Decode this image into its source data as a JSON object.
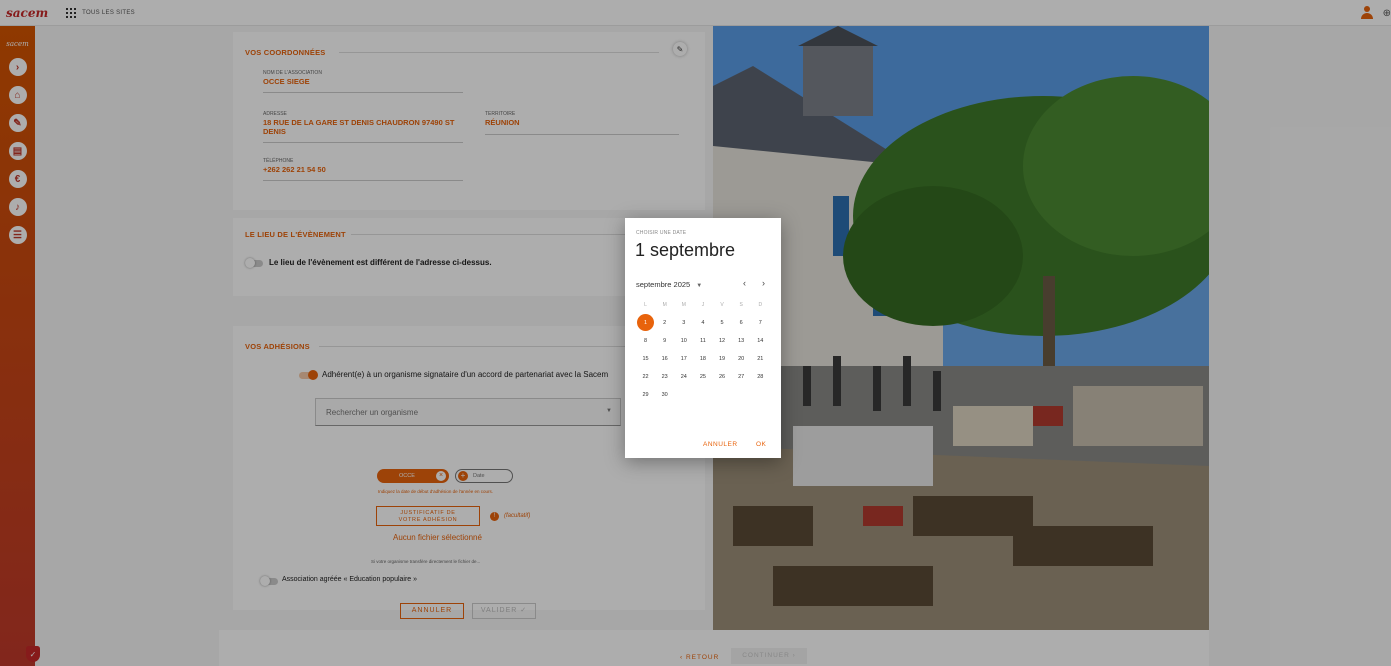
{
  "topbar": {
    "logo": "sacem",
    "all_sites": "TOUS LES SITES"
  },
  "sidebar": {
    "logo": "sacem",
    "items": [
      {
        "icon": "chevron-right-icon",
        "glyph": "›"
      },
      {
        "icon": "home-icon",
        "glyph": "⌂"
      },
      {
        "icon": "pencil-icon",
        "glyph": "✎"
      },
      {
        "icon": "chart-icon",
        "glyph": "▤"
      },
      {
        "icon": "euro-icon",
        "glyph": "€"
      },
      {
        "icon": "guitar-icon",
        "glyph": "♪"
      },
      {
        "icon": "list-icon",
        "glyph": "☰"
      }
    ]
  },
  "coords": {
    "title": "VOS COORDONNÉES",
    "assoc_label": "NOM DE L'ASSOCIATION",
    "assoc_value": "OCCE SIEGE",
    "address_label": "ADRESSE",
    "address_line1": "18 RUE DE LA GARE ST DENIS CHAUDRON 97490 ST",
    "address_line2": "DENIS",
    "territory_label": "TERRITOIRE",
    "territory_value": "RÉUNION",
    "phone_label": "TÉLÉPHONE",
    "phone_value": "+262 262 21 54 50"
  },
  "place": {
    "title": "LE LIEU DE L'ÉVÈNEMENT",
    "toggle_label": "Le lieu de l'évènement est différent de l'adresse ci-dessus."
  },
  "adhesions": {
    "title": "VOS ADHÉSIONS",
    "toggle_label": "Adhérent(e) à un organisme signataire d'un accord de partenariat avec la Sacem",
    "search_placeholder": "Rechercher un organisme",
    "chip_label": "OCCE",
    "date_chip_label": "Date",
    "hint": "Indiquez la date de début d'adhésion de l'année en cours.",
    "justif_line1": "JUSTIFICATIF DE",
    "justif_line2": "VOTRE ADHÉSION",
    "optional": "(facultatif)",
    "no_file": "Aucun fichier sélectionné",
    "transfer": "Si votre organisme transfère directement le fichier de...",
    "popular_label": "Association agréée « Education populaire »",
    "cancel": "ANNULER",
    "validate": "VALIDER ✓"
  },
  "bottom": {
    "back": "‹ RETOUR",
    "continue": "CONTINUER ›"
  },
  "datepicker": {
    "label": "CHOISIR UNE DATE",
    "selected_display": "1 septembre",
    "month": "septembre 2025",
    "weekdays": [
      "L",
      "M",
      "M",
      "J",
      "V",
      "S",
      "D"
    ],
    "selected_day": 1,
    "days_in_month": 30,
    "first_weekday_offset": 0,
    "cancel": "ANNULER",
    "ok": "OK"
  },
  "colors": {
    "accent": "#e8630c",
    "sidebar": "#c0392b"
  }
}
